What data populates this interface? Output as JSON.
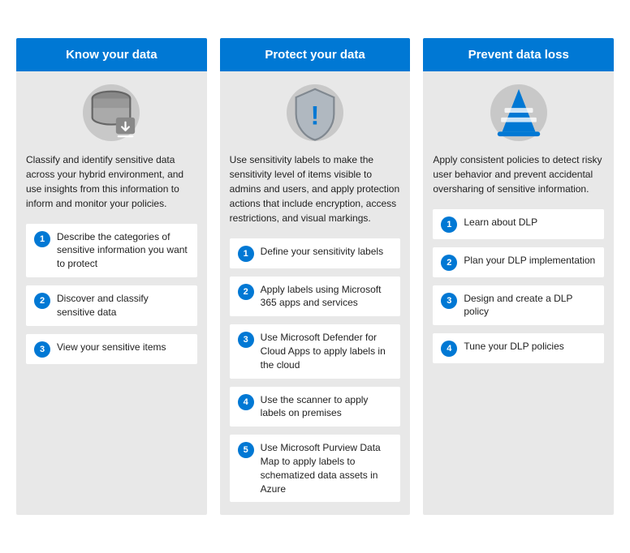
{
  "columns": [
    {
      "id": "know",
      "header": "Know your data",
      "icon": "database-download-icon",
      "description": "Classify and identify sensitive data across your hybrid environment, and use insights from this information to inform and monitor your policies.",
      "steps": [
        {
          "number": "1",
          "text": "Describe the categories of sensitive information you want to protect"
        },
        {
          "number": "2",
          "text": "Discover and classify sensitive data"
        },
        {
          "number": "3",
          "text": "View your sensitive items"
        }
      ]
    },
    {
      "id": "protect",
      "header": "Protect your data",
      "icon": "shield-alert-icon",
      "description": "Use sensitivity labels to make the sensitivity level of items visible to admins and users, and apply protection actions that include encryption, access restrictions, and visual markings.",
      "steps": [
        {
          "number": "1",
          "text": "Define your sensitivity labels"
        },
        {
          "number": "2",
          "text": "Apply labels using Microsoft 365 apps and services"
        },
        {
          "number": "3",
          "text": "Use Microsoft Defender for Cloud Apps to apply labels in the cloud"
        },
        {
          "number": "4",
          "text": "Use the scanner to apply labels on premises"
        },
        {
          "number": "5",
          "text": "Use Microsoft Purview Data Map to apply labels to schematized data assets in Azure"
        }
      ]
    },
    {
      "id": "prevent",
      "header": "Prevent data loss",
      "icon": "traffic-cone-icon",
      "description": "Apply consistent policies to detect risky user behavior and prevent accidental oversharing of sensitive information.",
      "steps": [
        {
          "number": "1",
          "text": "Learn about DLP"
        },
        {
          "number": "2",
          "text": "Plan your DLP implementation"
        },
        {
          "number": "3",
          "text": "Design and create a DLP policy"
        },
        {
          "number": "4",
          "text": "Tune your DLP policies"
        }
      ]
    }
  ]
}
